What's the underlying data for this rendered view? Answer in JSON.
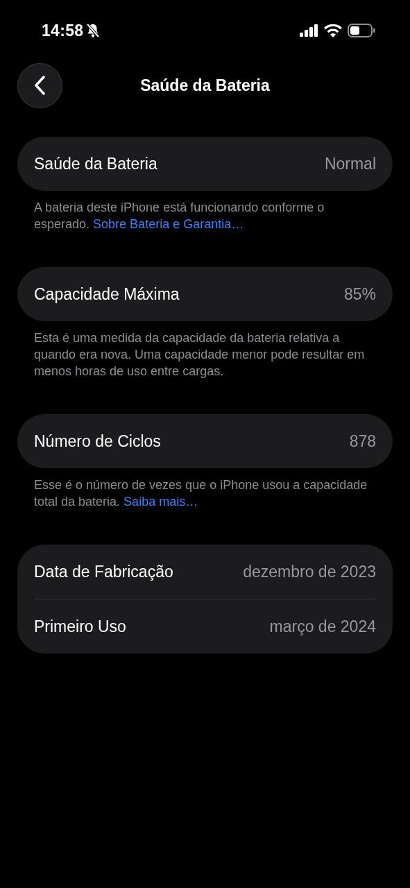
{
  "status_bar": {
    "time": "14:58"
  },
  "nav": {
    "title": "Saúde da Bateria"
  },
  "sections": [
    {
      "rows": [
        {
          "label": "Saúde da Bateria",
          "value": "Normal"
        }
      ],
      "footer": "A bateria deste iPhone está funcionando conforme o esperado.",
      "footer_link": "Sobre Bateria e Garantia…"
    },
    {
      "rows": [
        {
          "label": "Capacidade Máxima",
          "value": "85%"
        }
      ],
      "footer": "Esta é uma medida da capacidade da bateria relativa a quando era nova. Uma capacidade menor pode resultar em menos horas de uso entre cargas."
    },
    {
      "rows": [
        {
          "label": "Número de Ciclos",
          "value": "878"
        }
      ],
      "footer": "Esse é o número de vezes que o iPhone usou a capacidade total da bateria.",
      "footer_link": "Saiba mais…"
    },
    {
      "rows": [
        {
          "label": "Data de Fabricação",
          "value": "dezembro de 2023"
        },
        {
          "label": "Primeiro Uso",
          "value": "março de 2024"
        }
      ]
    }
  ]
}
